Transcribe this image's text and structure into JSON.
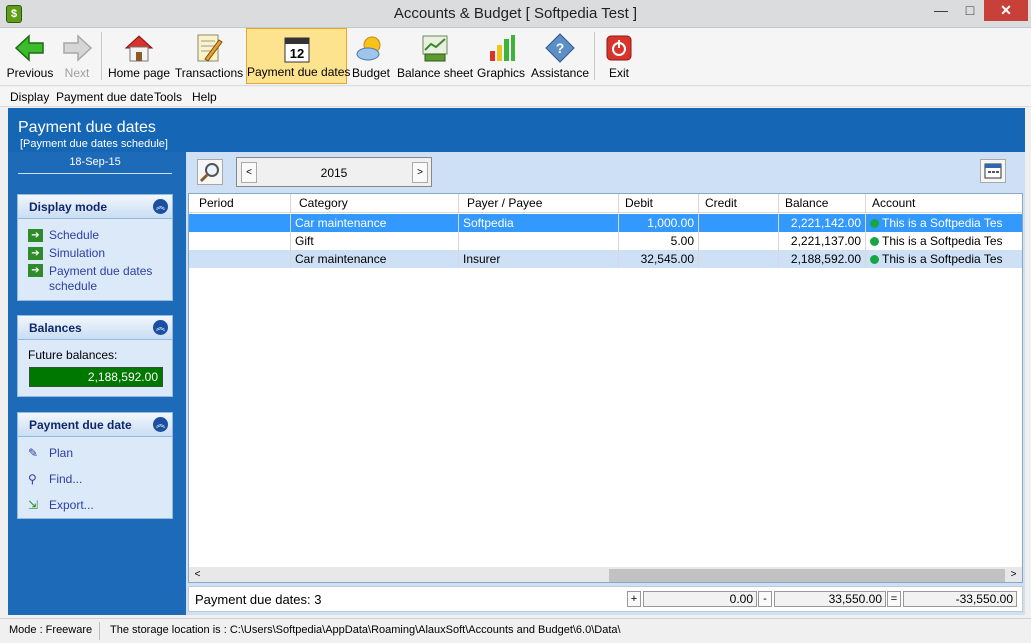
{
  "window": {
    "title": "Accounts & Budget [ Softpedia Test ]",
    "app_icon": "$",
    "minimize": "—",
    "maximize": "□",
    "close": "✕"
  },
  "toolbar": {
    "previous": "Previous",
    "next": "Next",
    "home": "Home page",
    "transactions": "Transactions",
    "payment_due_dates": "Payment due dates",
    "calendar_number": "12",
    "budget": "Budget",
    "balance_sheet": "Balance sheet",
    "graphics": "Graphics",
    "assistance": "Assistance",
    "exit": "Exit"
  },
  "menu": {
    "display": "Display",
    "payment_due_date": "Payment due date",
    "tools": "Tools",
    "help": "Help"
  },
  "header": {
    "title": "Payment due dates",
    "subtitle": "[Payment due dates schedule]",
    "date": "18-Sep-15"
  },
  "display_mode": {
    "title": "Display mode",
    "items": [
      "Schedule",
      "Simulation",
      "Payment due dates schedule"
    ]
  },
  "balances": {
    "title": "Balances",
    "label": "Future balances:",
    "value": "2,188,592.00"
  },
  "payment_due_date_panel": {
    "title": "Payment due date",
    "items": [
      "Plan",
      "Find...",
      "Export..."
    ]
  },
  "year_selector": {
    "year": "2015",
    "prev": "<",
    "next": ">"
  },
  "table": {
    "columns": [
      "Period",
      "Category",
      "Payer / Payee",
      "Debit",
      "Credit",
      "Balance",
      "Account"
    ],
    "rows": [
      {
        "period": "",
        "category": "Car maintenance",
        "payee": "Softpedia",
        "debit": "1,000.00",
        "credit": "",
        "balance": "2,221,142.00",
        "account": "This is a Softpedia Tes"
      },
      {
        "period": "",
        "category": "Gift",
        "payee": "",
        "debit": "5.00",
        "credit": "",
        "balance": "2,221,137.00",
        "account": "This is a Softpedia Tes"
      },
      {
        "period": "",
        "category": "Car maintenance",
        "payee": "Insurer",
        "debit": "32,545.00",
        "credit": "",
        "balance": "2,188,592.00",
        "account": "This is a Softpedia Tes"
      }
    ]
  },
  "footer": {
    "count_label": "Payment due dates: 3",
    "plus_sign": "+",
    "plus_value": "0.00",
    "minus_sign": "-",
    "minus_value": "33,550.00",
    "equals_sign": "=",
    "total_value": "-33,550.00"
  },
  "status": {
    "mode": "Mode : Freeware",
    "storage": "The storage location is : C:\\Users\\Softpedia\\AppData\\Roaming\\AlauxSoft\\Accounts and Budget\\6.0\\Data\\"
  },
  "colors": {
    "header_blue": "#1666b6",
    "selected_row": "#3399ff",
    "alt_row": "#cde0f5",
    "balance_green": "#007800",
    "account_dot": "#17a645"
  }
}
